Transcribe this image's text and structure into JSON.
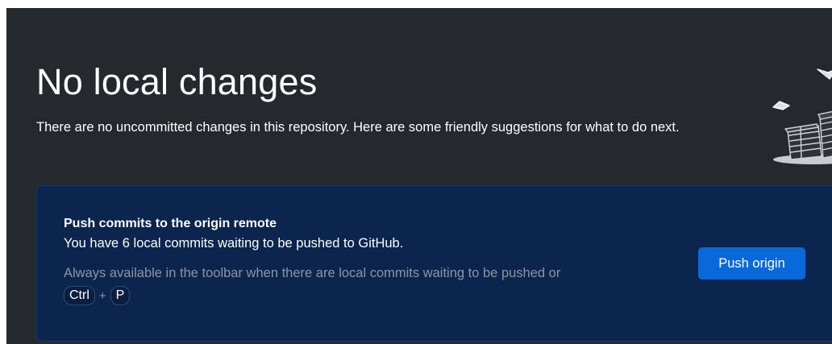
{
  "header": {
    "title": "No local changes",
    "subtitle": "There are no uncommitted changes in this repository. Here are some friendly suggestions for what to do next."
  },
  "push_card": {
    "title": "Push commits to the origin remote",
    "description": "You have 6 local commits waiting to be pushed to GitHub.",
    "hint": "Always available in the toolbar when there are local commits waiting to be pushed or",
    "shortcut": {
      "key1": "Ctrl",
      "separator": "+",
      "key2": "P"
    },
    "button_label": "Push origin"
  },
  "illustration": {
    "icon": "paper-stacks-illustration-icon"
  },
  "colors": {
    "background": "#24292e",
    "card_background": "#0b254f",
    "accent": "#0969da",
    "muted_text": "#8d96a0"
  }
}
